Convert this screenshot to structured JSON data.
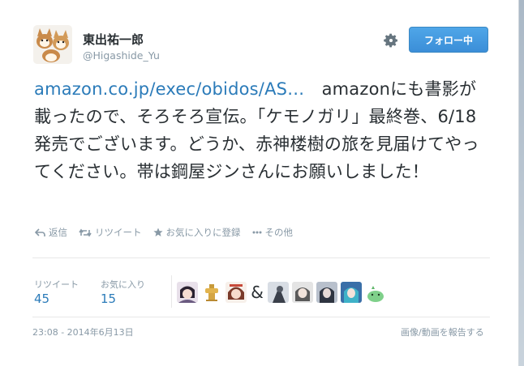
{
  "user": {
    "name": "東出祐一郎",
    "handle": "@Higashide_Yu"
  },
  "header": {
    "follow_label": "フォロー中"
  },
  "tweet": {
    "link_text": "amazon.co.jp/exec/obidos/AS…",
    "body": "　amazonにも書影が載ったので、そろそろ宣伝。「ケモノガリ」最終巻、6/18発売でございます。どうか、赤神楼樹の旅を見届けてやってください。帯は鋼屋ジンさんにお願いしました！"
  },
  "actions": {
    "reply": "返信",
    "retweet": "リツイート",
    "favorite": "お気に入りに登録",
    "more": "その他"
  },
  "stats": {
    "retweets_label": "リツイート",
    "retweets_count": "45",
    "favorites_label": "お気に入り",
    "favorites_count": "15"
  },
  "favoriters": {
    "separator": "&"
  },
  "footer": {
    "timestamp": "23:08 - 2014年6月13日",
    "report": "画像/動画を報告する"
  },
  "colors": {
    "link": "#2b7bb9",
    "follow_button": "#4fa6e8",
    "text": "#292f33",
    "muted": "#8899a6"
  }
}
